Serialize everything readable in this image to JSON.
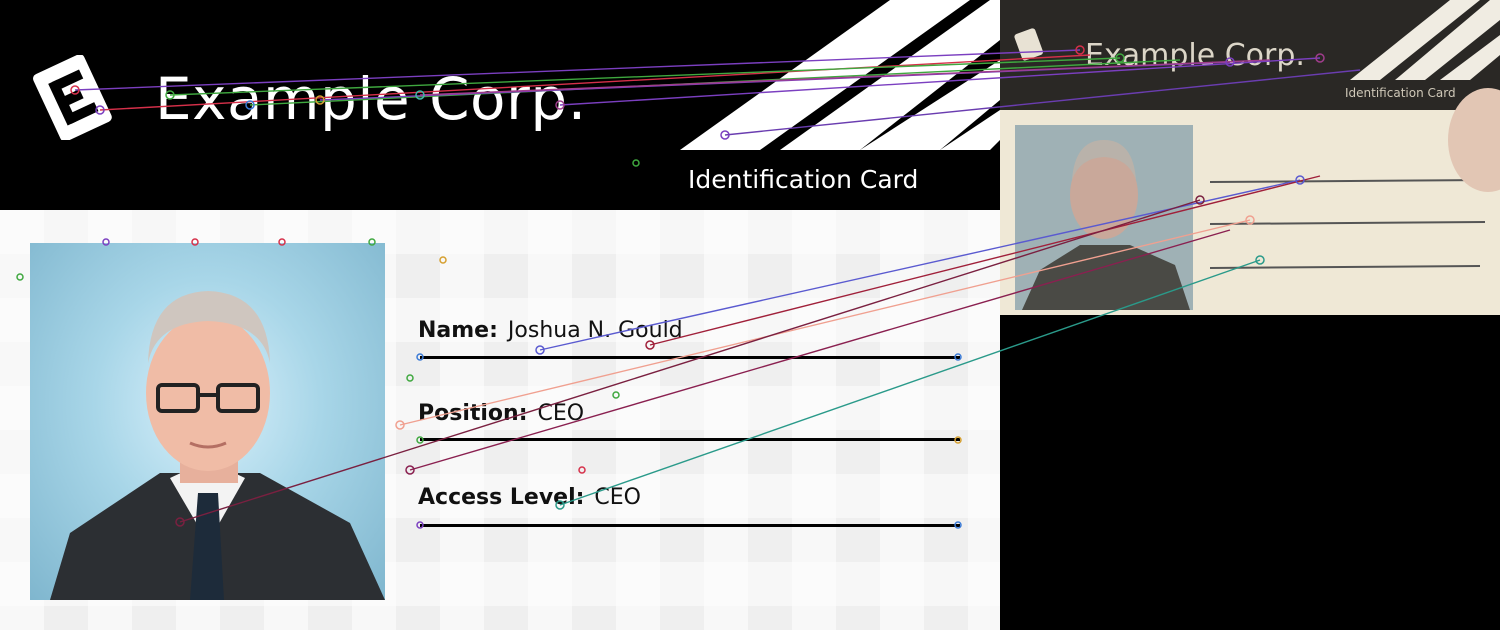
{
  "card": {
    "company": "Example Corp.",
    "subtitle": "Identification Card",
    "fields": [
      {
        "label": "Name:",
        "value": "Joshua N. Gould"
      },
      {
        "label": "Position:",
        "value": "CEO"
      },
      {
        "label": "Access Level:",
        "value": "CEO"
      }
    ]
  },
  "photo": {
    "company": "Example Corp.",
    "subtitle": "Identification Card"
  },
  "colors": {
    "header": "#000000",
    "body": "#f4f4f4",
    "photo_bg": "#a8d6e8",
    "match_lines": [
      "#7b3fc0",
      "#d6304a",
      "#3fa83f",
      "#a03d8c",
      "#3fb7a8",
      "#f0a090"
    ]
  }
}
